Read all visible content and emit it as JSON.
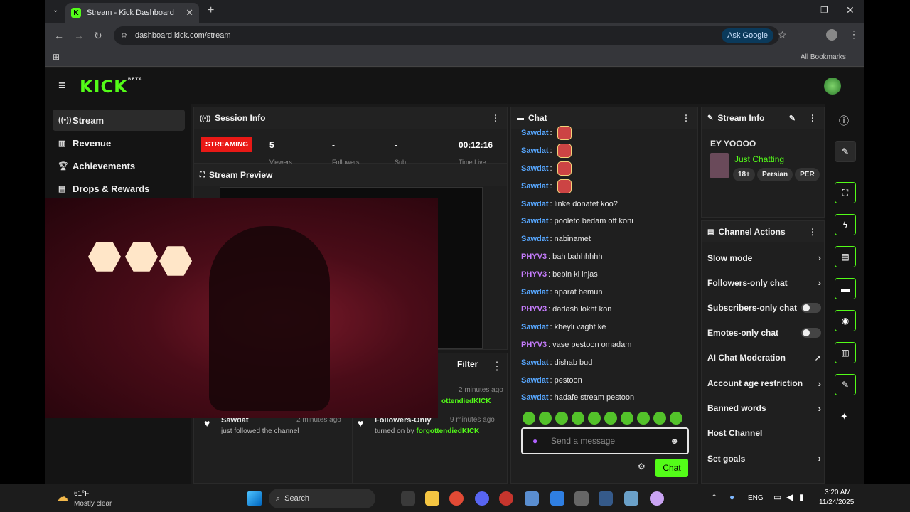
{
  "browser": {
    "tab_title": "Stream - Kick Dashboard",
    "url": "dashboard.kick.com/stream",
    "ask_google": "Ask Google",
    "all_bookmarks": "All Bookmarks"
  },
  "app": {
    "logo": "KICK",
    "logo_badge": "BETA"
  },
  "sidebar": {
    "items": [
      {
        "label": "Stream",
        "icon": "broadcast-icon"
      },
      {
        "label": "Revenue",
        "icon": "chart-icon"
      },
      {
        "label": "Achievements",
        "icon": "trophy-icon"
      },
      {
        "label": "Drops & Rewards",
        "icon": "gift-icon"
      }
    ]
  },
  "session": {
    "title": "Session Info",
    "status": "STREAMING",
    "viewers": "5",
    "viewers_label": "Viewers",
    "followers": "-",
    "followers_label": "Followers",
    "subs": "-",
    "subs_label": "Sub",
    "time": "00:12:16",
    "time_label": "Time Live"
  },
  "preview": {
    "title": "Stream Preview"
  },
  "activity": {
    "filter": "Filter",
    "items": [
      {
        "user": "Sawdat",
        "text": "just followed the channel",
        "time": "2 minutes ago"
      },
      {
        "user": "Followers-Only",
        "text": "turned on by",
        "by": "forgottendiedKICK",
        "time": "9 minutes ago"
      }
    ],
    "partial_time": "2 minutes ago",
    "partial_user": "ottendiedKICK"
  },
  "chat": {
    "title": "Chat",
    "placeholder": "Send a message",
    "send_label": "Chat",
    "messages": [
      {
        "user": "Sawdat",
        "text": "",
        "emote": true,
        "color": "#57a7ff"
      },
      {
        "user": "Sawdat",
        "text": "",
        "emote": true,
        "color": "#57a7ff"
      },
      {
        "user": "Sawdat",
        "text": "",
        "emote": true,
        "color": "#57a7ff"
      },
      {
        "user": "Sawdat",
        "text": "",
        "emote": true,
        "color": "#57a7ff"
      },
      {
        "user": "Sawdat",
        "text": "linke donatet koo?",
        "color": "#57a7ff"
      },
      {
        "user": "Sawdat",
        "text": "pooleto bedam off koni",
        "color": "#57a7ff"
      },
      {
        "user": "Sawdat",
        "text": "nabinamet",
        "color": "#57a7ff"
      },
      {
        "user": "PHYV3",
        "text": "bah bahhhhhh",
        "color": "#c77dff"
      },
      {
        "user": "PHYV3",
        "text": "bebin ki injas",
        "color": "#c77dff"
      },
      {
        "user": "Sawdat",
        "text": "aparat bemun",
        "color": "#57a7ff"
      },
      {
        "user": "PHYV3",
        "text": "dadash lokht kon",
        "color": "#c77dff"
      },
      {
        "user": "Sawdat",
        "text": "kheyli vaght ke",
        "color": "#57a7ff"
      },
      {
        "user": "PHYV3",
        "text": "vase pestoon omadam",
        "color": "#c77dff"
      },
      {
        "user": "Sawdat",
        "text": "dishab bud",
        "color": "#57a7ff"
      },
      {
        "user": "Sawdat",
        "text": "pestoon",
        "color": "#57a7ff"
      },
      {
        "user": "Sawdat",
        "text": "hadafe stream pestoon",
        "color": "#57a7ff"
      }
    ]
  },
  "stream_info": {
    "title": "Stream Info",
    "stream_title": "EY YOOOO",
    "category": "Just Chatting",
    "tags": [
      "18+",
      "Persian",
      "PER"
    ]
  },
  "channel_actions": {
    "title": "Channel Actions",
    "items": [
      {
        "label": "Slow mode",
        "control": "chevron"
      },
      {
        "label": "Followers-only chat",
        "control": "chevron"
      },
      {
        "label": "Subscribers-only chat",
        "control": "toggle"
      },
      {
        "label": "Emotes-only chat",
        "control": "toggle"
      },
      {
        "label": "AI Chat Moderation",
        "control": "external"
      },
      {
        "label": "Account age restriction",
        "control": "chevron"
      },
      {
        "label": "Banned words",
        "control": "chevron"
      },
      {
        "label": "Host Channel",
        "control": "none"
      },
      {
        "label": "Set goals",
        "control": "chevron"
      }
    ]
  },
  "taskbar": {
    "temp": "61°F",
    "weather": "Mostly clear",
    "search": "Search",
    "lang": "ENG",
    "time": "3:20 AM",
    "date": "11/24/2025"
  },
  "colors": {
    "accent": "#53fc18",
    "live": "#e91916"
  }
}
